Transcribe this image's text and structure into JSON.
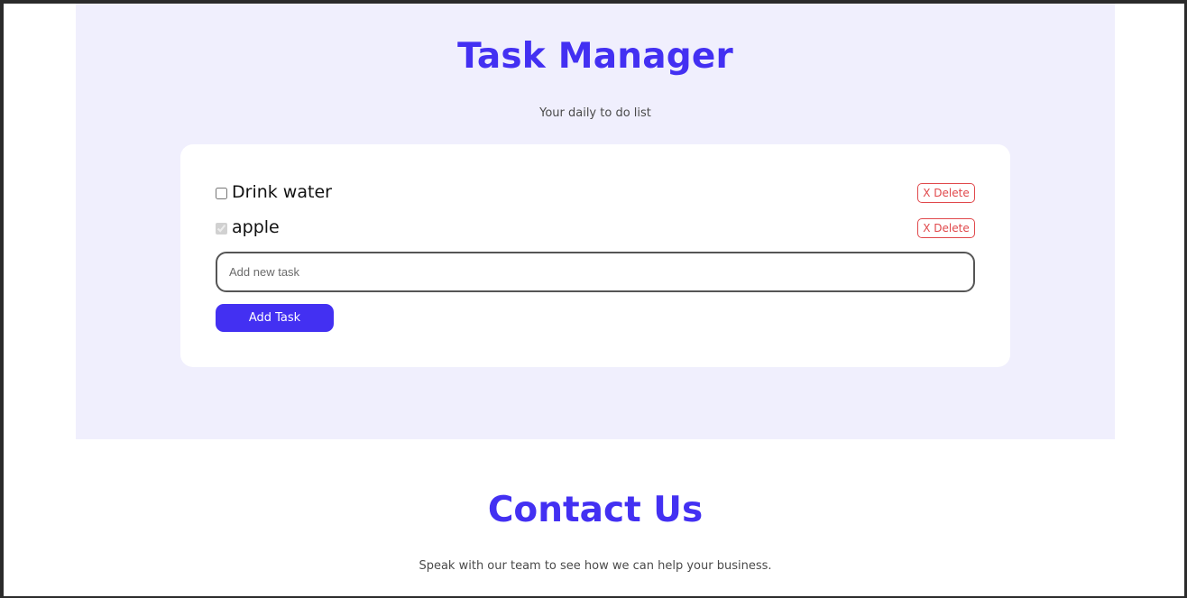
{
  "task_manager": {
    "title": "Task Manager",
    "subtitle": "Your daily to do list",
    "tasks": [
      {
        "label": "Drink water",
        "completed": false,
        "delete_label": "X Delete"
      },
      {
        "label": "apple",
        "completed": true,
        "delete_label": "X Delete"
      }
    ],
    "input": {
      "value": "",
      "placeholder": "Add new task"
    },
    "add_button_label": "Add Task"
  },
  "contact": {
    "title": "Contact Us",
    "subtitle": "Speak with our team to see how we can help your business."
  },
  "colors": {
    "accent": "#4330f2",
    "section_background": "#f0effd",
    "delete": "#e0484b"
  }
}
